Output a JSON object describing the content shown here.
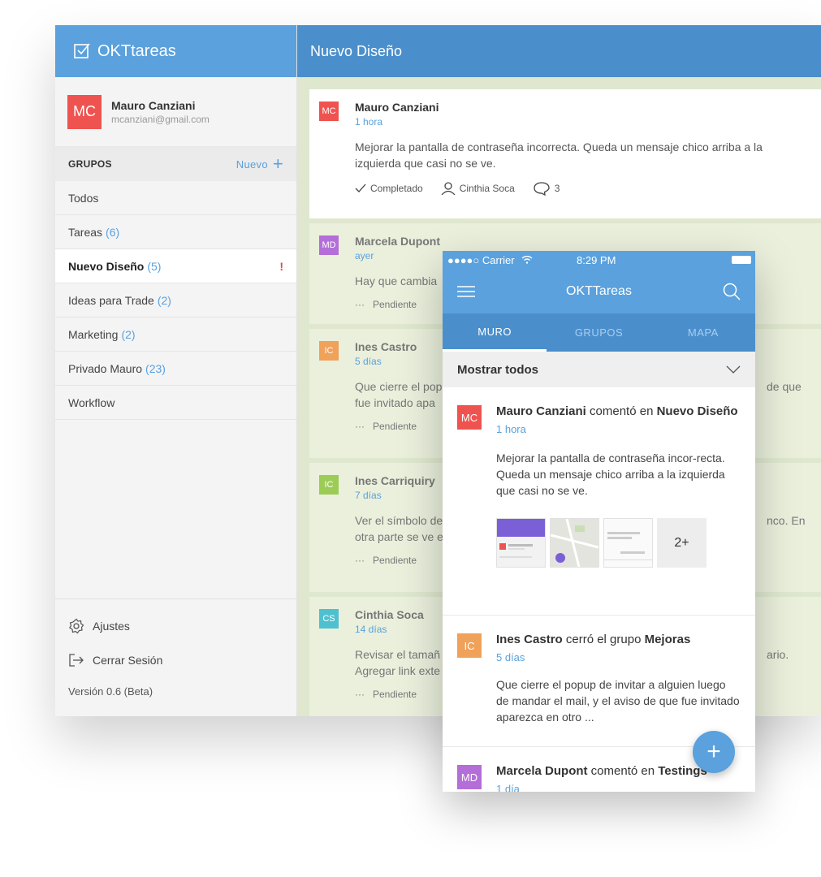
{
  "app": {
    "name": "OKTtareas",
    "group_title": "Nuevo Diseño"
  },
  "user": {
    "initials": "MC",
    "name": "Mauro Canziani",
    "email": "mcanziani@gmail.com"
  },
  "groups": {
    "header": "GRUPOS",
    "new_label": "Nuevo",
    "items": [
      {
        "label": "Todos",
        "count": ""
      },
      {
        "label": "Tareas",
        "count": "(6)"
      },
      {
        "label": "Nuevo Diseño",
        "count": "(5)",
        "alert": "!"
      },
      {
        "label": "Ideas para Trade",
        "count": "(2)"
      },
      {
        "label": "Marketing",
        "count": "(2)"
      },
      {
        "label": "Privado Mauro",
        "count": "(23)"
      },
      {
        "label": "Workflow",
        "count": ""
      }
    ]
  },
  "footer": {
    "settings": "Ajustes",
    "logout": "Cerrar Sesión",
    "version": "Versión 0.6 (Beta)"
  },
  "posts": [
    {
      "initials": "MC",
      "name": "Mauro Canziani",
      "time": "1 hora",
      "text": "Mejorar la pantalla de contraseña incorrecta. Queda un mensaje chico arriba a la izquierda que casi no se ve.",
      "status": "Completado",
      "assignee": "Cinthia Soca",
      "comments": "3"
    },
    {
      "initials": "MD",
      "name": "Marcela Dupont",
      "time": "ayer",
      "text": "Hay que cambia",
      "status": "Pendiente"
    },
    {
      "initials": "IC",
      "name": "Ines Castro",
      "time": "5 días",
      "text": "Que cierre el pop",
      "text2": "fue invitado apa",
      "text_right": "de que",
      "status": "Pendiente"
    },
    {
      "initials": "IC",
      "name": "Ines Carriquiry",
      "time": "7 días",
      "text": "Ver el símbolo de",
      "text2": "otra parte se ve e",
      "text_right": "nco. En",
      "status": "Pendiente"
    },
    {
      "initials": "CS",
      "name": "Cinthia Soca",
      "time": "14 días",
      "text": "Revisar el tamañ",
      "text2": "Agregar link exte",
      "text_right": "ario.",
      "status": "Pendiente"
    }
  ],
  "phone": {
    "status": {
      "carrier": "●●●●○ Carrier",
      "time": "8:29 PM"
    },
    "title": "OKTTareas",
    "tabs": [
      "MURO",
      "GRUPOS",
      "MAPA"
    ],
    "filter": "Mostrar todos",
    "feed": [
      {
        "initials": "MC",
        "who": "Mauro Canziani",
        "action": " comentó en ",
        "target": "Nuevo Diseño",
        "time": "1 hora",
        "text": "Mejorar la pantalla de contraseña incor-recta. Queda un mensaje chico arriba a la izquierda que casi no se ve.",
        "more": "2+"
      },
      {
        "initials": "IC",
        "who": "Ines Castro",
        "action": " cerró el grupo ",
        "target": "Mejoras",
        "time": "5 días",
        "text": "Que cierre el popup de invitar a alguien luego de mandar el mail, y el aviso de que fue invitado aparezca en otro ..."
      },
      {
        "initials": "MD",
        "who": "Marcela Dupont",
        "action": " comentó en ",
        "target": "Testings",
        "time": "1 día"
      }
    ],
    "fab": "+"
  },
  "colors": {
    "primary": "#5aa1dd",
    "primary_dark": "#4a8fcc",
    "avatar_mc": "#ef5350",
    "avatar_md": "#b36ed8",
    "avatar_ic": "#f0a15a",
    "avatar_ic2": "#9ccc55",
    "avatar_cs": "#4fc0cf"
  }
}
